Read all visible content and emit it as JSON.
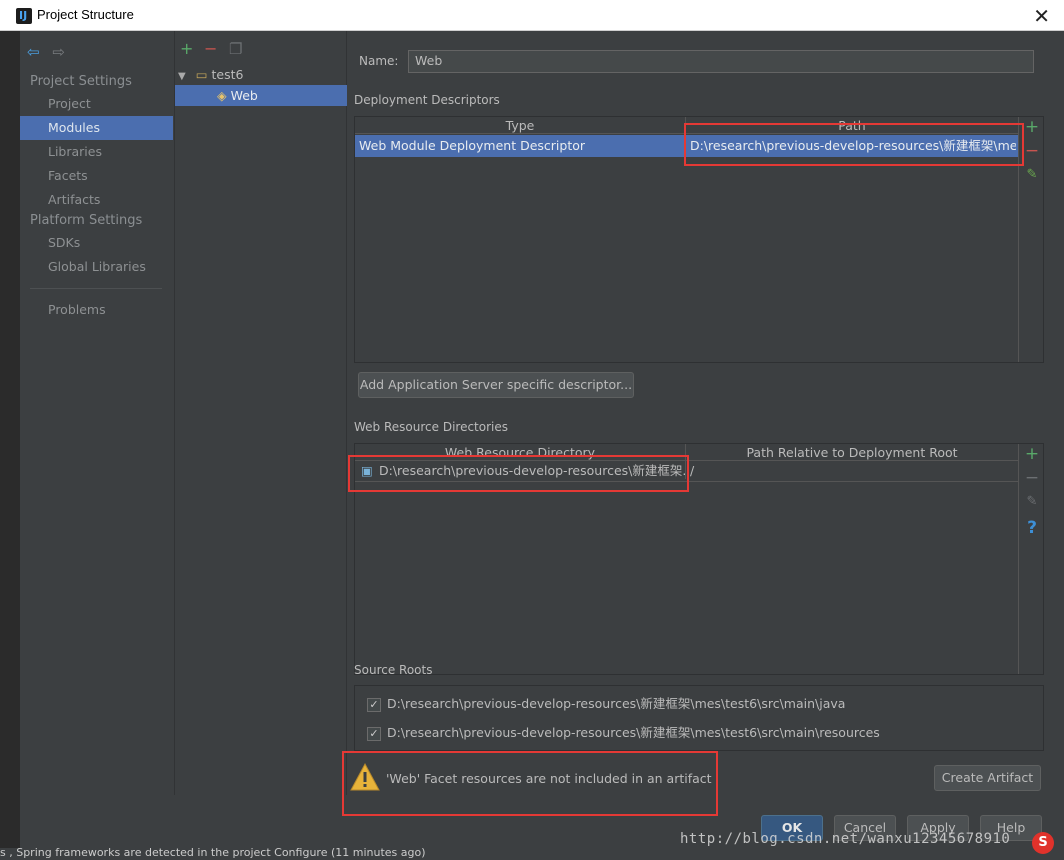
{
  "window": {
    "title": "Project Structure"
  },
  "nav": {
    "project_settings_header": "Project Settings",
    "items_project": [
      "Project",
      "Modules",
      "Libraries",
      "Facets",
      "Artifacts"
    ],
    "platform_settings_header": "Platform Settings",
    "items_platform": [
      "SDKs",
      "Global Libraries"
    ],
    "problems": "Problems",
    "selected": "Modules"
  },
  "tree": {
    "root": "test6",
    "child": "Web"
  },
  "main": {
    "name_label": "Name:",
    "name_value": "Web",
    "deployment": {
      "section_label": "Deployment Descriptors",
      "col_type": "Type",
      "col_path": "Path",
      "row_type": "Web Module Deployment Descriptor",
      "row_path": "D:\\research\\previous-develop-resources\\新建框架\\mes\\t",
      "add_server_button": "Add Application Server specific descriptor..."
    },
    "web_resources": {
      "section_label": "Web Resource Directories",
      "col_dir": "Web Resource Directory",
      "col_rel": "Path Relative to Deployment Root",
      "row_dir": "D:\\research\\previous-develop-resources\\新建框架...",
      "row_rel": "/"
    },
    "source_roots": {
      "section_label": "Source Roots",
      "items": [
        "D:\\research\\previous-develop-resources\\新建框架\\mes\\test6\\src\\main\\java",
        "D:\\research\\previous-develop-resources\\新建框架\\mes\\test6\\src\\main\\resources"
      ]
    },
    "warning_text": "'Web' Facet resources are not included in an artifact",
    "create_artifact_button": "Create Artifact"
  },
  "buttons": {
    "ok": "OK",
    "cancel": "Cancel",
    "apply": "Apply",
    "help": "Help"
  },
  "watermark": "http://blog.csdn.net/wanxu12345678910",
  "statusbar": "s , Spring frameworks are detected in the project Configure (11 minutes ago)",
  "colors": {
    "selection": "#4b6eaf",
    "highlight_red": "#e53935",
    "add_green": "#59a869",
    "remove_red": "#c75450"
  }
}
